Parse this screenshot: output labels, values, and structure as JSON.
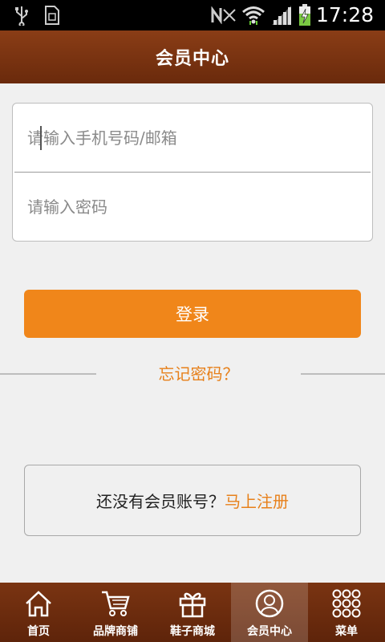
{
  "status_bar": {
    "time": "17:28",
    "icons": [
      "usb-icon",
      "sim-card-icon",
      "nfc-icon",
      "wifi-icon",
      "signal-icon",
      "battery-charging-icon"
    ]
  },
  "header": {
    "title": "会员中心"
  },
  "login_form": {
    "account_placeholder": "请输入手机号码/邮箱",
    "password_placeholder": "请输入密码",
    "login_label": "登录",
    "forgot_label": "忘记密码？"
  },
  "register": {
    "prompt": "还没有会员账号？",
    "link": "马上注册"
  },
  "tabbar": {
    "active_index": 3,
    "items": [
      {
        "label": "首页",
        "icon": "home-icon"
      },
      {
        "label": "品牌商铺",
        "icon": "cart-icon"
      },
      {
        "label": "鞋子商城",
        "icon": "gift-icon"
      },
      {
        "label": "会员中心",
        "icon": "user-icon"
      },
      {
        "label": "菜单",
        "icon": "menu-grid-icon"
      }
    ]
  },
  "colors": {
    "accent": "#f0861a",
    "header_brown": "#7a3412",
    "link_orange": "#e7801a"
  }
}
